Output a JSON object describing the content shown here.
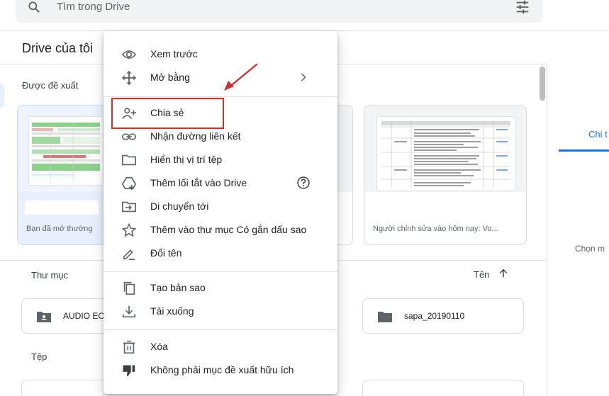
{
  "search": {
    "placeholder": "Tìm trong Drive",
    "icon": "search-icon",
    "filter_icon": "tune-icon"
  },
  "page": {
    "title": "Drive của tôi"
  },
  "suggested": {
    "label": "Được đề xuất",
    "cards": [
      {
        "caption": "Bạn đã mở thường",
        "thumbnail": "spreadsheet"
      },
      {
        "caption": "",
        "thumbnail": "blank"
      },
      {
        "caption": "Người chỉnh sửa vào hôm nay: Vo...",
        "thumbnail": "document"
      }
    ]
  },
  "folders": {
    "label": "Thư mục",
    "sort_label": "Tên",
    "items": [
      {
        "name": "AUDIO EC",
        "icon": "shared-folder-icon"
      },
      {
        "name": "sapa_20190110",
        "icon": "folder-icon"
      }
    ]
  },
  "files": {
    "label": "Tệp"
  },
  "right_panel": {
    "tab": "Chi t",
    "hint": "Chọn m"
  },
  "context_menu": {
    "items": [
      {
        "label": "Xem trước",
        "icon": "eye-icon"
      },
      {
        "label": "Mở bằng",
        "icon": "move-icon",
        "has_submenu": true
      },
      {
        "label": "Chia sẻ",
        "icon": "person-add-icon",
        "highlighted": true
      },
      {
        "label": "Nhận đường liên kết",
        "icon": "link-icon"
      },
      {
        "label": "Hiển thị vị trí tệp",
        "icon": "folder-outline-icon"
      },
      {
        "label": "Thêm lối tắt vào Drive",
        "icon": "add-shortcut-icon",
        "has_help": true
      },
      {
        "label": "Di chuyển tới",
        "icon": "move-to-icon"
      },
      {
        "label": "Thêm vào thư mục Có gắn dấu sao",
        "icon": "star-icon"
      },
      {
        "label": "Đổi tên",
        "icon": "rename-icon"
      },
      {
        "label": "Tạo bản sao",
        "icon": "copy-icon"
      },
      {
        "label": "Tải xuống",
        "icon": "download-icon"
      },
      {
        "label": "Xóa",
        "icon": "trash-icon"
      },
      {
        "label": "Không phải mục đề xuất hữu ích",
        "icon": "thumb-down-icon"
      }
    ]
  },
  "colors": {
    "accent": "#1a73e8",
    "highlight_border": "#d32f2f",
    "text": "#202124",
    "muted": "#5f6368"
  }
}
